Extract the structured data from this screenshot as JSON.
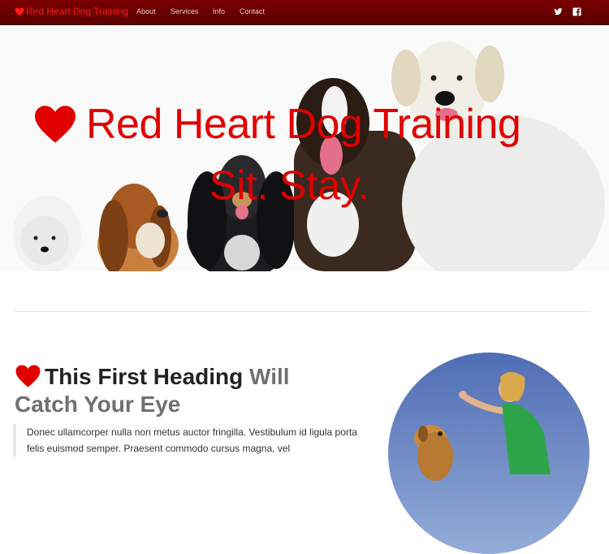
{
  "nav": {
    "brand": "Red Heart Dog Training",
    "items": [
      "About",
      "Services",
      "Info",
      "Contact"
    ]
  },
  "hero": {
    "title": "Red Heart Dog Training",
    "subtitle": "Sit. Stay."
  },
  "content": {
    "heading_primary": "This First Heading",
    "heading_muted": "Will Catch Your Eye",
    "paragraph": "Donec ullamcorper nulla non metus auctor fringilla. Vestibulum id ligula porta felis euismod semper. Praesent commodo cursus magna, vel"
  },
  "icons": {
    "brand": "heart-icon",
    "twitter": "twitter-icon",
    "facebook": "facebook-icon"
  },
  "colors": {
    "brand_red": "#e00000",
    "nav_bg": "#6a0000"
  }
}
